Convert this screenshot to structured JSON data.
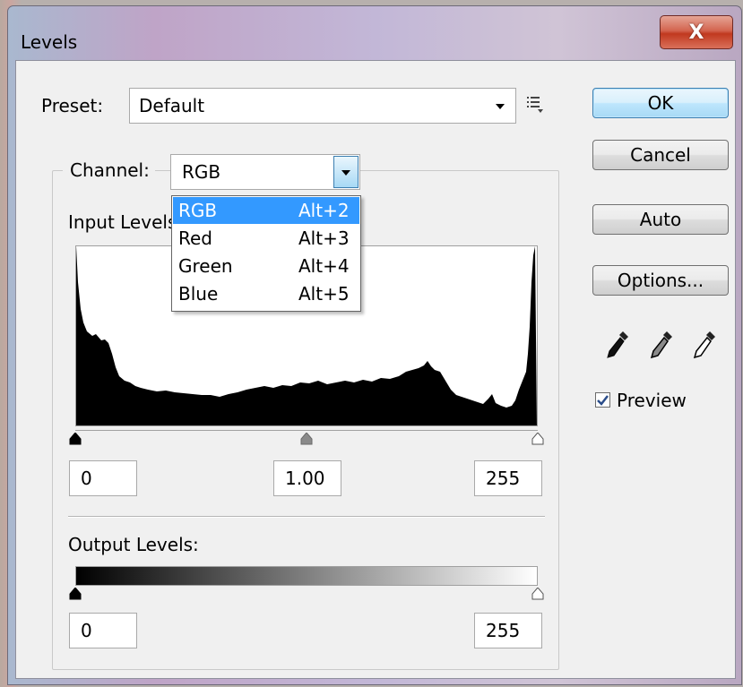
{
  "window": {
    "title": "Levels",
    "close_glyph": "X"
  },
  "preset": {
    "label": "Preset:",
    "value": "Default",
    "menu_icon": "preset-options-icon"
  },
  "buttons": {
    "ok": "OK",
    "cancel": "Cancel",
    "auto": "Auto",
    "options": "Options..."
  },
  "channel": {
    "label": "Channel:",
    "value": "RGB"
  },
  "channel_menu": {
    "items": [
      {
        "name": "RGB",
        "shortcut": "Alt+2",
        "selected": true
      },
      {
        "name": "Red",
        "shortcut": "Alt+3"
      },
      {
        "name": "Green",
        "shortcut": "Alt+4"
      },
      {
        "name": "Blue",
        "shortcut": "Alt+5"
      }
    ]
  },
  "input_levels": {
    "label": "Input Levels:",
    "black": "0",
    "gamma": "1.00",
    "white": "255"
  },
  "output_levels": {
    "label": "Output Levels:",
    "black": "0",
    "white": "255"
  },
  "eyedroppers": [
    "black-point-eyedropper-icon",
    "gray-point-eyedropper-icon",
    "white-point-eyedropper-icon"
  ],
  "preview": {
    "label": "Preview",
    "checked": true
  }
}
